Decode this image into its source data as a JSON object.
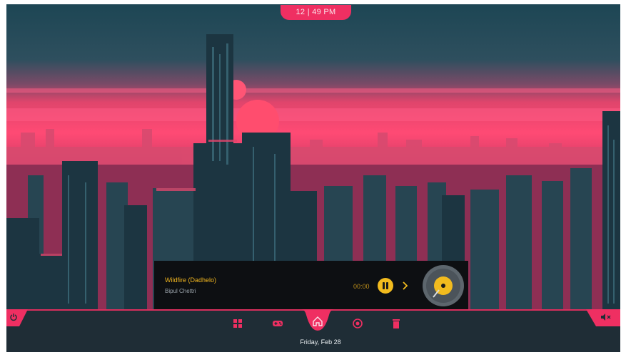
{
  "clock": {
    "time": "12 | 49 PM"
  },
  "player": {
    "title": "Wildfire (Dadhelo)",
    "artist": "Bipul Chettri",
    "time": "00:00",
    "controls": {
      "pause_icon": "pause-icon",
      "next_icon": "chevron-right-icon"
    }
  },
  "dock": {
    "date": "Friday, Feb 28",
    "items": [
      {
        "name": "apps-icon",
        "active": false
      },
      {
        "name": "gamepad-icon",
        "active": false
      },
      {
        "name": "home-icon",
        "active": true
      },
      {
        "name": "circle-icon",
        "active": false
      },
      {
        "name": "trash-icon",
        "active": false
      }
    ],
    "left_icon": "power-icon",
    "right_icon": "volume-mute-icon"
  },
  "colors": {
    "accent": "#ef2f62",
    "music_accent": "#f2bb1e",
    "dock_bg": "#1f2d36",
    "player_bg": "#0d0f12"
  }
}
